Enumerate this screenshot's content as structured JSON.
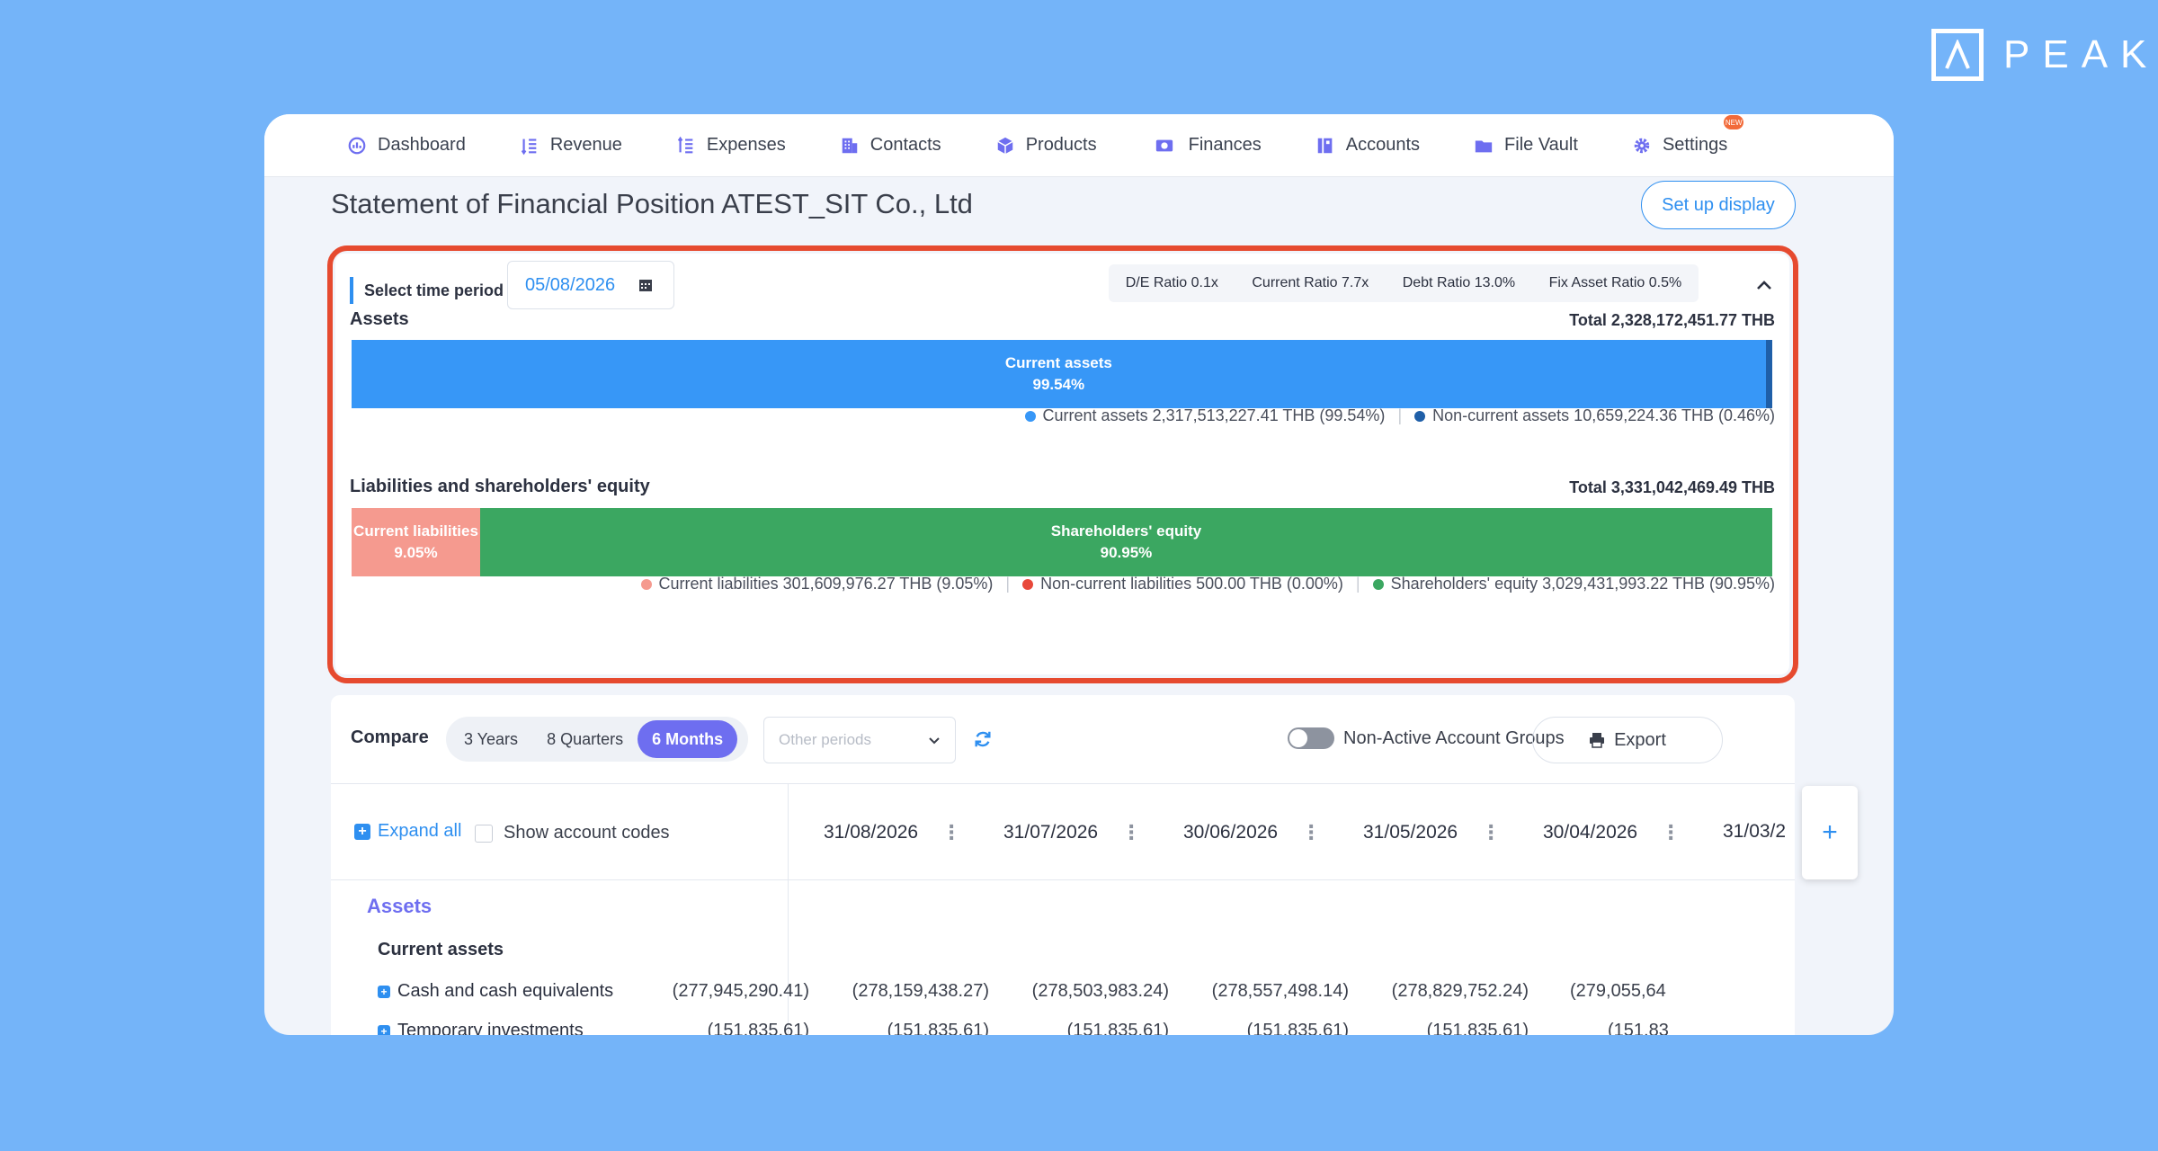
{
  "brand": {
    "text": "PEAK"
  },
  "nav": {
    "items": [
      {
        "label": "Dashboard",
        "icon": "dashboard-icon"
      },
      {
        "label": "Revenue",
        "icon": "revenue-icon"
      },
      {
        "label": "Expenses",
        "icon": "expenses-icon"
      },
      {
        "label": "Contacts",
        "icon": "contacts-icon"
      },
      {
        "label": "Products",
        "icon": "box-icon"
      },
      {
        "label": "Finances",
        "icon": "money-icon"
      },
      {
        "label": "Accounts",
        "icon": "ledger-icon"
      },
      {
        "label": "File Vault",
        "icon": "folder-icon"
      },
      {
        "label": "Settings",
        "icon": "gear-icon",
        "badge": "NEW"
      }
    ]
  },
  "page": {
    "title": "Statement of Financial Position ATEST_SIT Co., Ltd",
    "setup_button": "Set up display"
  },
  "summary": {
    "period_label": "Select time period",
    "date": "05/08/2026",
    "ratios": [
      "D/E Ratio 0.1x",
      "Current Ratio 7.7x",
      "Debt Ratio 13.0%",
      "Fix Asset Ratio 0.5%"
    ],
    "assets": {
      "title": "Assets",
      "total": "Total 2,328,172,451.77 THB",
      "bar": [
        {
          "label": "Current assets",
          "pct_label": "99.54%",
          "share": 99.54,
          "color": "#3797f7"
        },
        {
          "label": "",
          "pct_label": "",
          "share": 0.46,
          "color": "#1f5fa8"
        }
      ],
      "legend": [
        {
          "text": "Current assets 2,317,513,227.41 THB (99.54%)",
          "color": "#3797f7"
        },
        {
          "text": "Non-current assets 10,659,224.36 THB (0.46%)",
          "color": "#1f5fa8"
        }
      ]
    },
    "liabilities": {
      "title": "Liabilities and shareholders' equity",
      "total": "Total 3,331,042,469.49 THB",
      "bar": [
        {
          "label": "Current liabilities",
          "pct_label": "9.05%",
          "share": 9.05,
          "color": "#f59a8f"
        },
        {
          "label": "Shareholders' equity",
          "pct_label": "90.95%",
          "share": 90.95,
          "color": "#3ba761"
        }
      ],
      "legend": [
        {
          "text": "Current liabilities 301,609,976.27 THB (9.05%)",
          "color": "#f59a8f"
        },
        {
          "text": "Non-current liabilities 500.00 THB (0.00%)",
          "color": "#e8483a"
        },
        {
          "text": "Shareholders' equity 3,029,431,993.22 THB (90.95%)",
          "color": "#3ba761"
        }
      ]
    }
  },
  "compare": {
    "label": "Compare",
    "options": [
      "3 Years",
      "8 Quarters",
      "6 Months"
    ],
    "active": "6 Months",
    "other_periods_placeholder": "Other periods",
    "toggle_label": "Non-Active Account Groups",
    "toggle_on": false,
    "export_label": "Export",
    "expand_all": "Expand all",
    "show_codes": "Show account codes",
    "dates": [
      "31/08/2026",
      "31/07/2026",
      "30/06/2026",
      "31/05/2026",
      "30/04/2026",
      "31/03/2"
    ],
    "section": "Assets",
    "subsection": "Current assets",
    "rows": [
      {
        "name": "Cash and cash equivalents",
        "values": [
          "(277,945,290.41)",
          "(278,159,438.27)",
          "(278,503,983.24)",
          "(278,557,498.14)",
          "(278,829,752.24)",
          "(279,055,64"
        ]
      },
      {
        "name": "Temporary investments",
        "values": [
          "(151,835.61)",
          "(151,835.61)",
          "(151,835.61)",
          "(151,835.61)",
          "(151,835.61)",
          "(151,83"
        ]
      }
    ],
    "add_column": "+"
  }
}
